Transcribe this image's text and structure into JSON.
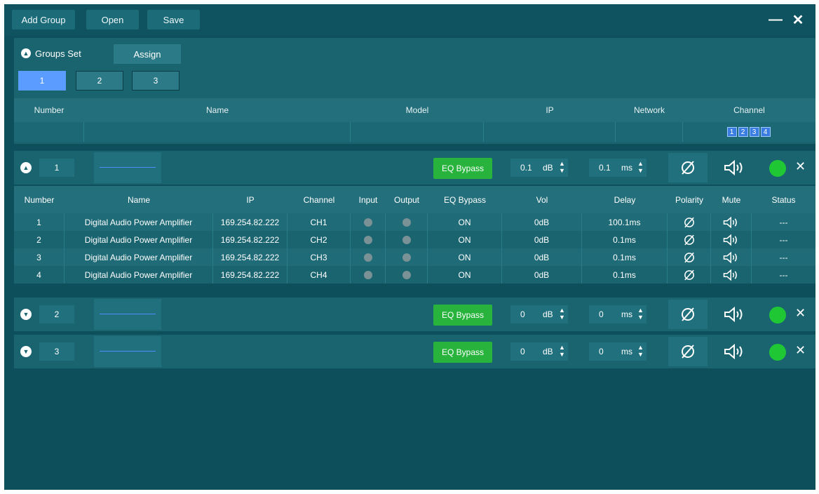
{
  "toolbar": {
    "add_group": "Add Group",
    "open": "Open",
    "save": "Save",
    "minimize": "—",
    "close": "✕"
  },
  "groups_set": {
    "title": "Groups Set",
    "assign": "Assign",
    "tabs": [
      "1",
      "2",
      "3"
    ],
    "active_tab": "1",
    "columns": [
      "Number",
      "Name",
      "Model",
      "IP",
      "Network",
      "Channel"
    ],
    "channel_boxes": [
      "1",
      "2",
      "3",
      "4"
    ]
  },
  "groups": [
    {
      "number": "1",
      "expanded": true,
      "eq_label": "EQ Bypass",
      "vol_value": "0.1",
      "vol_unit": "dB",
      "delay_value": "0.1",
      "delay_unit": "ms"
    },
    {
      "number": "2",
      "expanded": false,
      "eq_label": "EQ Bypass",
      "vol_value": "0",
      "vol_unit": "dB",
      "delay_value": "0",
      "delay_unit": "ms"
    },
    {
      "number": "3",
      "expanded": false,
      "eq_label": "EQ Bypass",
      "vol_value": "0",
      "vol_unit": "dB",
      "delay_value": "0",
      "delay_unit": "ms"
    }
  ],
  "channel_table": {
    "columns": [
      "Number",
      "Name",
      "IP",
      "Channel",
      "Input",
      "Output",
      "EQ Bypass",
      "Vol",
      "Delay",
      "Polarity",
      "Mute",
      "Status"
    ],
    "rows": [
      {
        "number": "1",
        "name": "Digital Audio Power Amplifier",
        "ip": "169.254.82.222",
        "channel": "CH1",
        "eq": "ON",
        "vol": "0dB",
        "delay": "100.1ms",
        "status": "---"
      },
      {
        "number": "2",
        "name": "Digital Audio Power Amplifier",
        "ip": "169.254.82.222",
        "channel": "CH2",
        "eq": "ON",
        "vol": "0dB",
        "delay": "0.1ms",
        "status": "---"
      },
      {
        "number": "3",
        "name": "Digital Audio Power Amplifier",
        "ip": "169.254.82.222",
        "channel": "CH3",
        "eq": "ON",
        "vol": "0dB",
        "delay": "0.1ms",
        "status": "---"
      },
      {
        "number": "4",
        "name": "Digital Audio Power Amplifier",
        "ip": "169.254.82.222",
        "channel": "CH4",
        "eq": "ON",
        "vol": "0dB",
        "delay": "0.1ms",
        "status": "---"
      }
    ]
  },
  "colors": {
    "background": "#0d4f5a",
    "panel": "#1a6470",
    "eq_button": "#27b33c",
    "status_online": "#1fc735",
    "active_tab": "#5a9cff"
  },
  "icons": {
    "polarity": "polarity-icon",
    "mute": "speaker-icon",
    "expand": "chevron-up-icon",
    "collapse": "chevron-down-icon"
  }
}
